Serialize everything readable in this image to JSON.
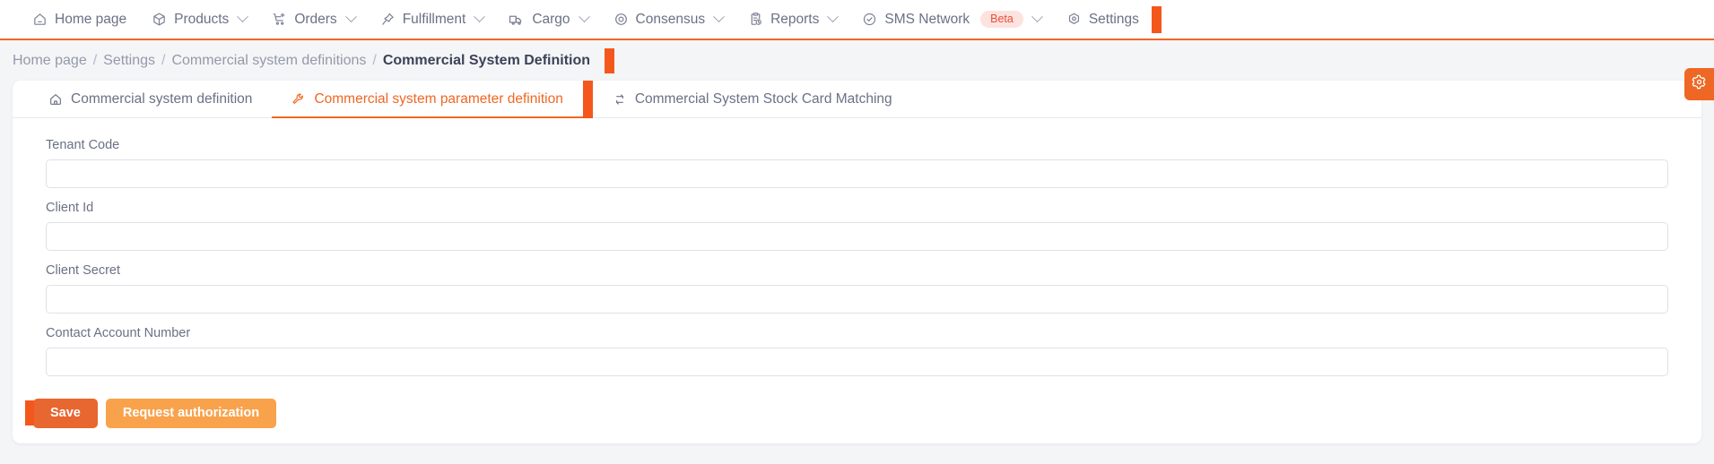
{
  "theme": {
    "accent": "#ef6724",
    "accent_dark": "#e8662f",
    "accent_light": "#f9a24c",
    "cursor_marker": "#f4571c",
    "text_muted": "#6b7185",
    "text_strong": "#3c4257"
  },
  "topnav": {
    "items": [
      {
        "label": "Home page",
        "icon": "home-icon",
        "caret": false
      },
      {
        "label": "Products",
        "icon": "box-icon",
        "caret": true
      },
      {
        "label": "Orders",
        "icon": "cart-plus-icon",
        "caret": true
      },
      {
        "label": "Fulfillment",
        "icon": "pin-icon",
        "caret": true
      },
      {
        "label": "Cargo",
        "icon": "truck-icon",
        "caret": true
      },
      {
        "label": "Consensus",
        "icon": "target-icon",
        "caret": true
      },
      {
        "label": "Reports",
        "icon": "clipboard-clock-icon",
        "caret": true
      },
      {
        "label": "SMS Network",
        "icon": "check-circle-icon",
        "caret": true,
        "badge": "Beta"
      },
      {
        "label": "Settings",
        "icon": "hex-gear-icon",
        "caret": false
      }
    ]
  },
  "breadcrumb": {
    "separator": "/",
    "items": [
      {
        "label": "Home page",
        "active": false
      },
      {
        "label": "Settings",
        "active": false
      },
      {
        "label": "Commercial system definitions",
        "active": false
      },
      {
        "label": "Commercial System Definition",
        "active": true
      }
    ]
  },
  "tabs": [
    {
      "label": "Commercial system definition",
      "icon": "home-outline-icon",
      "active": false
    },
    {
      "label": "Commercial system parameter definition",
      "icon": "wrench-icon",
      "active": true
    },
    {
      "label": "Commercial System Stock Card Matching",
      "icon": "swap-icon",
      "active": false
    }
  ],
  "form": {
    "fields": [
      {
        "label": "Tenant Code",
        "value": "",
        "placeholder": ""
      },
      {
        "label": "Client Id",
        "value": "",
        "placeholder": ""
      },
      {
        "label": "Client Secret",
        "value": "",
        "placeholder": ""
      },
      {
        "label": "Contact Account Number",
        "value": "",
        "placeholder": ""
      }
    ]
  },
  "actions": {
    "save_label": "Save",
    "request_auth_label": "Request authorization"
  },
  "fab": {
    "icon": "gear-icon"
  }
}
